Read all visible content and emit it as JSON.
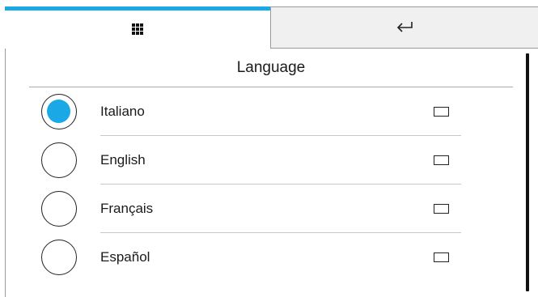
{
  "tabs": {
    "menu_icon": "grid-menu-icon",
    "back_icon": "return-arrow-icon",
    "active_color": "#1aa9e6"
  },
  "page": {
    "title": "Language"
  },
  "languages": [
    {
      "label": "Italiano",
      "selected": true
    },
    {
      "label": "English",
      "selected": false
    },
    {
      "label": "Français",
      "selected": false
    },
    {
      "label": "Español",
      "selected": false
    }
  ],
  "colors": {
    "accent": "#1aa9e6",
    "inactive_tab_bg": "#f0f0f0"
  }
}
